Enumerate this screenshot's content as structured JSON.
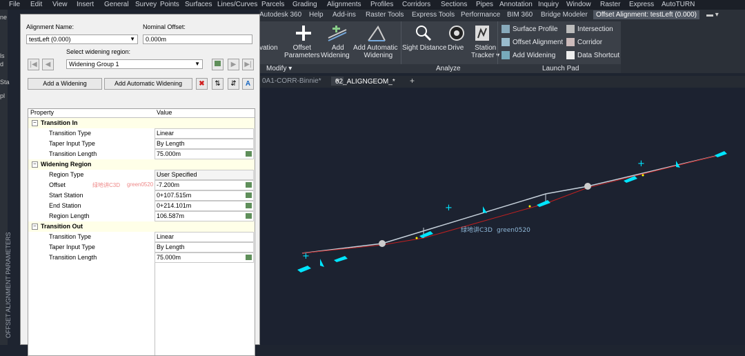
{
  "menubar": [
    "File",
    "Edit",
    "View",
    "Insert",
    "General",
    "Survey",
    "Points",
    "Surfaces",
    "Lines/Curves",
    "Parcels",
    "Grading",
    "Alignments",
    "Profiles",
    "Corridors",
    "Sections",
    "Pipes",
    "Annotation",
    "Inquiry",
    "Window",
    "Raster",
    "Express",
    "AutoTURN"
  ],
  "ribbon_tabs": [
    "Autodesk 360",
    "Help",
    "Add-ins",
    "Raster Tools",
    "Express Tools",
    "Performance",
    "BIM 360",
    "Bridge Modeler",
    "Offset Alignment: testLeft (0.000)"
  ],
  "ribbon": {
    "buttons": [
      {
        "label": "vation"
      },
      {
        "label": "Offset\nParameters"
      },
      {
        "label": "Add\nWidening"
      },
      {
        "label": "Add Automatic\nWidening"
      },
      {
        "label": "Sight Distance"
      },
      {
        "label": "Drive"
      },
      {
        "label": "Station\nTracker"
      }
    ],
    "small_buttons": [
      "Surface Profile",
      "Offset Alignment",
      "Add Widening",
      "Intersection",
      "Corridor",
      "Data Shortcut"
    ],
    "panels": [
      "Modify",
      "Analyze",
      "Launch Pad"
    ]
  },
  "doc_tabs": [
    "0A1-CORR-Binnie*",
    "02_ALIGNGEOM_*"
  ],
  "palette": {
    "title": "OFFSET ALIGNMENT PARAMETERS",
    "alignment_name_label": "Alignment Name:",
    "alignment_name_value": "testLeft (0.000)",
    "nominal_offset_label": "Nominal Offset:",
    "nominal_offset_value": "0.000m",
    "select_region_label": "Select widening region:",
    "region_value": "Widening Group 1",
    "add_widening_label": "Add a Widening",
    "add_auto_widening_label": "Add Automatic Widening",
    "col_property": "Property",
    "col_value": "Value",
    "groups": [
      {
        "name": "Transition In",
        "rows": [
          {
            "p": "Transition Type",
            "v": "Linear"
          },
          {
            "p": "Taper Input Type",
            "v": "By Length"
          },
          {
            "p": "Transition Length",
            "v": "75.000m"
          }
        ]
      },
      {
        "name": "Widening Region",
        "rows": [
          {
            "p": "Region Type",
            "v": "User Specified"
          },
          {
            "p": "Offset",
            "v": "-7.200m"
          },
          {
            "p": "Start Station",
            "v": "0+107.515m"
          },
          {
            "p": "End Station",
            "v": "0+214.101m"
          },
          {
            "p": "Region Length",
            "v": "106.587m"
          }
        ]
      },
      {
        "name": "Transition Out",
        "rows": [
          {
            "p": "Transition Type",
            "v": "Linear"
          },
          {
            "p": "Taper Input Type",
            "v": "By Length"
          },
          {
            "p": "Transition Length",
            "v": "75.000m"
          }
        ]
      }
    ]
  },
  "watermark": {
    "zh": "绿地讲C3D",
    "id": "green0520"
  },
  "left_strip": [
    "ne",
    "ls",
    "d",
    "Sta",
    "pl"
  ],
  "colors": {
    "accent": "#00e5ff",
    "offset_line": "#c02020",
    "ribbon_bg": "#3b4048"
  }
}
